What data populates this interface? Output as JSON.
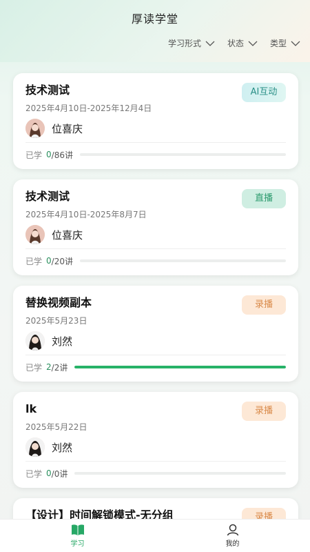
{
  "header": {
    "title": "厚读学堂",
    "filters": [
      "学习形式",
      "状态",
      "类型"
    ]
  },
  "courses": [
    {
      "title": "技术测试",
      "badge": "AI互动",
      "badge_type": "ai",
      "date": "2025年4月10日-2025年12月4日",
      "teacher": "位喜庆",
      "progress_label": "已学",
      "done": "0",
      "total_text": "/86讲",
      "progress": 0
    },
    {
      "title": "技术测试",
      "badge": "直播",
      "badge_type": "live",
      "date": "2025年4月10日-2025年8月7日",
      "teacher": "位喜庆",
      "progress_label": "已学",
      "done": "0",
      "total_text": "/20讲",
      "progress": 0
    },
    {
      "title": "替换视频副本",
      "badge": "录播",
      "badge_type": "rec",
      "date": "2025年5月23日",
      "teacher": "刘然",
      "progress_label": "已学",
      "done": "2",
      "total_text": "/2讲",
      "progress": 1
    },
    {
      "title": "lk",
      "badge": "录播",
      "badge_type": "rec",
      "date": "2025年5月22日",
      "teacher": "刘然",
      "progress_label": "已学",
      "done": "0",
      "total_text": "/0讲",
      "progress": 0
    },
    {
      "title": "【设计】时间解锁模式-无分组",
      "badge": "录播",
      "badge_type": "rec"
    }
  ],
  "tabbar": {
    "study_label": "学习",
    "mine_label": "我的",
    "study_icon": "book-icon",
    "mine_icon": "user-icon",
    "active_color": "#27a866"
  }
}
